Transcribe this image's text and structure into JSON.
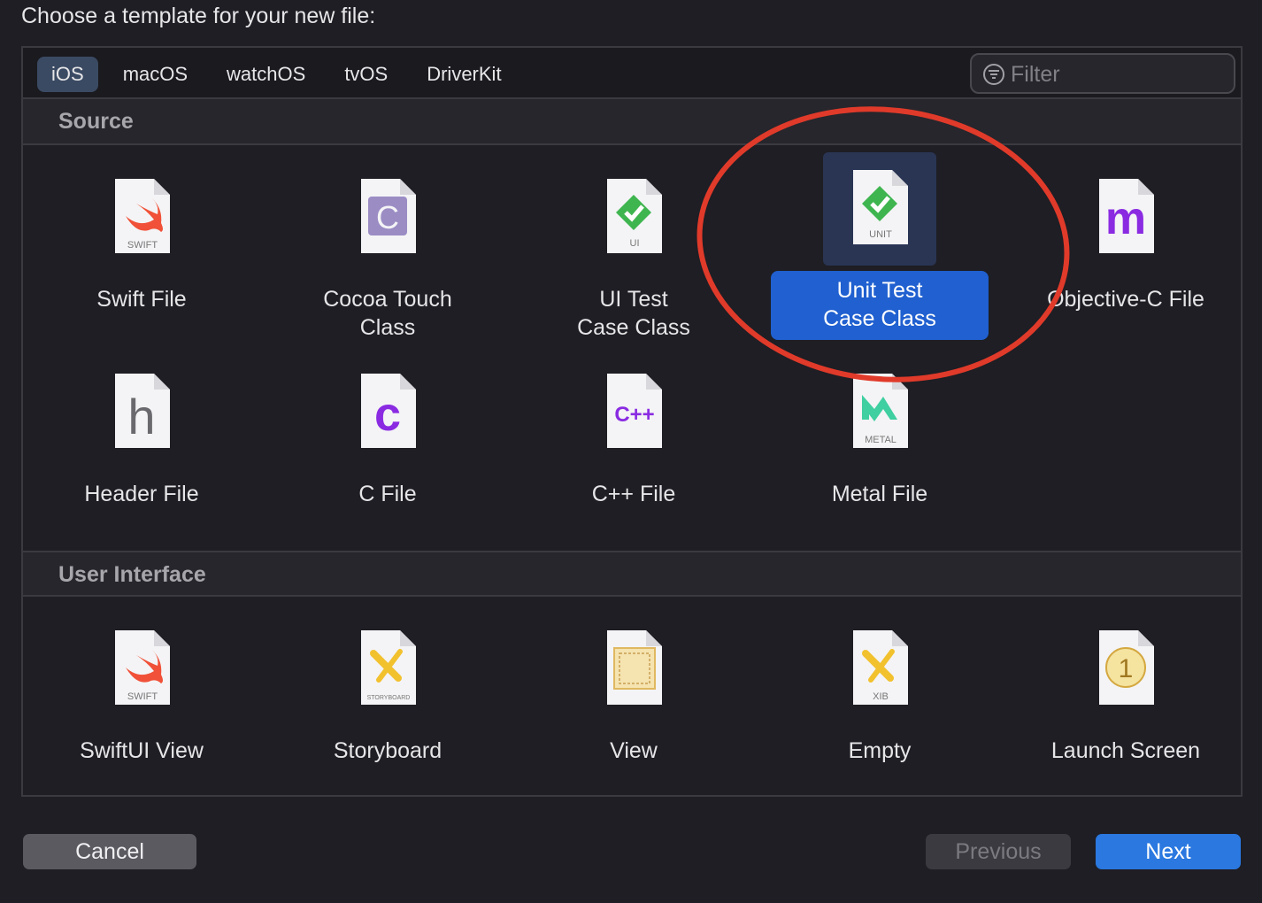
{
  "prompt": "Choose a template for your new file:",
  "tabs": [
    {
      "label": "iOS",
      "active": true
    },
    {
      "label": "macOS",
      "active": false
    },
    {
      "label": "watchOS",
      "active": false
    },
    {
      "label": "tvOS",
      "active": false
    },
    {
      "label": "DriverKit",
      "active": false
    }
  ],
  "filter": {
    "placeholder": "Filter",
    "value": "",
    "icon": "filter-icon"
  },
  "sections": {
    "source": {
      "title": "Source",
      "items": [
        {
          "label": "Swift File",
          "icon": "swift-file-icon",
          "badge": "SWIFT"
        },
        {
          "label": "Cocoa Touch\nClass",
          "icon": "cocoa-touch-class-icon",
          "badge": "C"
        },
        {
          "label": "UI Test\nCase Class",
          "icon": "ui-test-icon",
          "badge": "UI"
        },
        {
          "label": "Unit Test\nCase Class",
          "icon": "unit-test-icon",
          "badge": "UNIT",
          "selected": true
        },
        {
          "label": "Objective-C File",
          "icon": "objective-c-file-icon",
          "badge": "m"
        },
        {
          "label": "Header File",
          "icon": "header-file-icon",
          "badge": "h"
        },
        {
          "label": "C File",
          "icon": "c-file-icon",
          "badge": "c"
        },
        {
          "label": "C++ File",
          "icon": "cpp-file-icon",
          "badge": "C++"
        },
        {
          "label": "Metal File",
          "icon": "metal-file-icon",
          "badge": "METAL"
        }
      ]
    },
    "user_interface": {
      "title": "User Interface",
      "items": [
        {
          "label": "SwiftUI View",
          "icon": "swiftui-view-icon",
          "badge": "SWIFT"
        },
        {
          "label": "Storyboard",
          "icon": "storyboard-icon",
          "badge": "STORYBOARD"
        },
        {
          "label": "View",
          "icon": "view-icon",
          "badge": ""
        },
        {
          "label": "Empty",
          "icon": "xib-icon",
          "badge": "XIB"
        },
        {
          "label": "Launch Screen",
          "icon": "launch-screen-icon",
          "badge": "1"
        }
      ]
    }
  },
  "buttons": {
    "cancel": "Cancel",
    "previous": "Previous",
    "next": "Next"
  },
  "colors": {
    "accent": "#2a78e0",
    "selection": "#2060d0",
    "annotation": "#e03a2a",
    "background": "#1e1e24"
  }
}
